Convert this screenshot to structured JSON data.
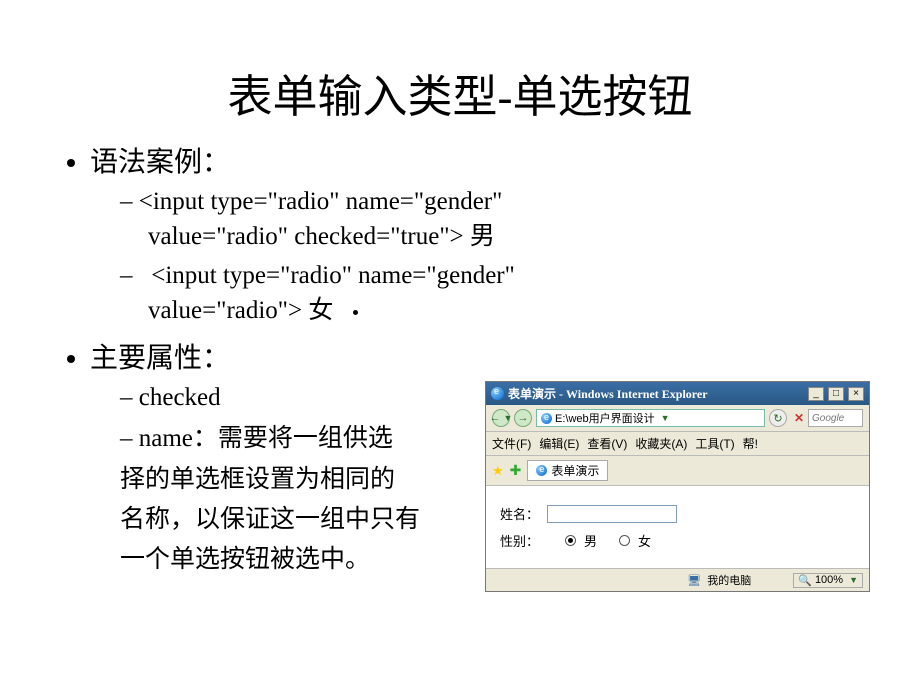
{
  "slide": {
    "title": "表单输入类型-单选按钮",
    "bullet1": "语法案例：",
    "code1a": "<input type=\"radio\" name=\"gender\"",
    "code1b": "value=\"radio\" checked=\"true\"> 男",
    "code2a": "<input type=\"radio\" name=\"gender\"",
    "code2b": "value=\"radio\">  女",
    "bullet2": "主要属性：",
    "attr1": "checked",
    "attr2_label": "name：",
    "attr2_text1": "需要将一组供选",
    "attr2_text2": "择的单选框设置为相同的",
    "attr2_text3": "名称，以保证这一组中只有",
    "attr2_text4": "一个单选按钮被选中。"
  },
  "ie": {
    "title": "表单演示 - Windows Internet Explorer",
    "addr": "E:\\web用户界面设计",
    "searchPlaceholder": "Google",
    "menu": {
      "file": "文件(F)",
      "edit": "编辑(E)",
      "view": "查看(V)",
      "fav": "收藏夹(A)",
      "tools": "工具(T)",
      "help": "帮!"
    },
    "tabLabel": "表单演示",
    "form": {
      "nameLabel": "姓名：",
      "genderLabel": "性别：",
      "male": "男",
      "female": "女"
    },
    "status": {
      "computer": "我的电脑",
      "zoom": "100%"
    }
  }
}
